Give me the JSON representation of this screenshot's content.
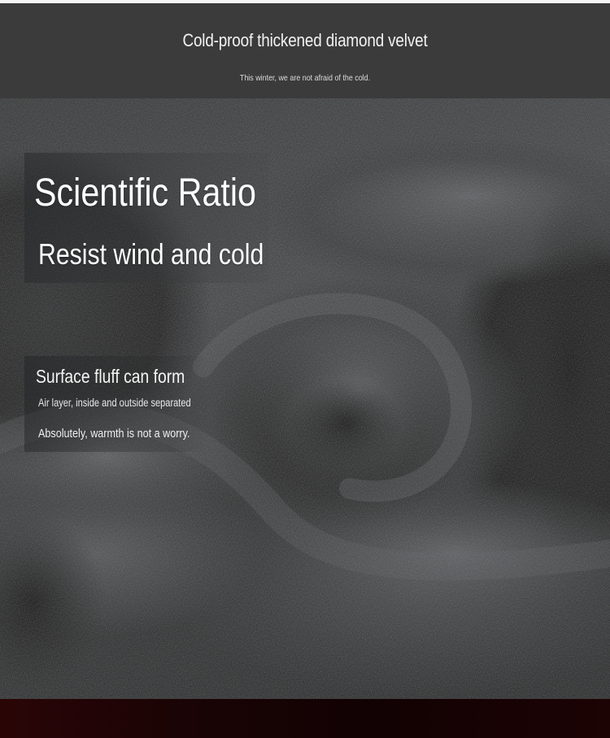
{
  "header": {
    "title": "Cold-proof thickened diamond velvet",
    "subtitle": "This winter, we are not afraid of the cold."
  },
  "hero": {
    "headline": "Scientific Ratio",
    "subheadline": "Resist wind and cold"
  },
  "feature": {
    "title": "Surface fluff can form",
    "line1": "Air layer, inside and outside separated",
    "line2": "Absolutely, warmth is not a worry."
  },
  "colors": {
    "header_bg": "#3b3b3b",
    "fabric_tone": "#3a3d3f",
    "bottom_strip": "#1a0405",
    "text": "#ffffff"
  }
}
